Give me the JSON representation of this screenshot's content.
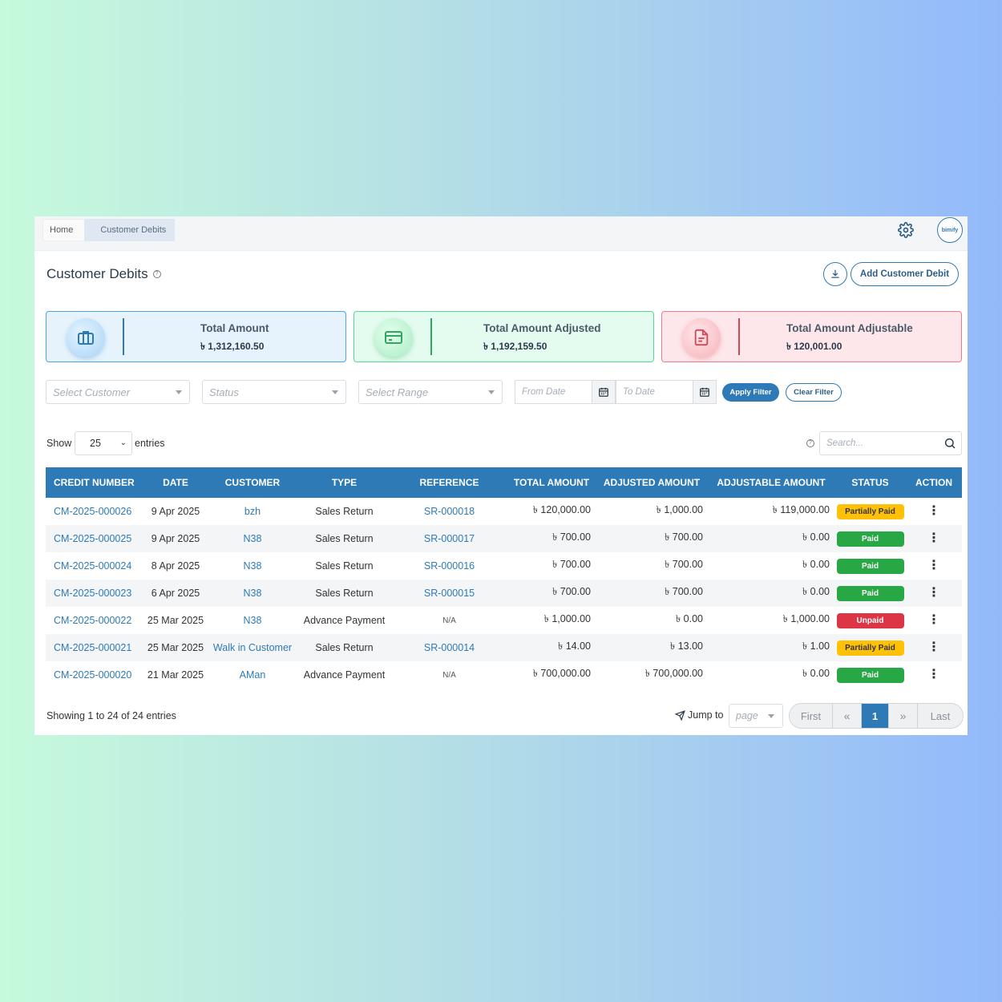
{
  "breadcrumb": {
    "home": "Home",
    "current": "Customer Debits"
  },
  "header": {
    "logo_text": "bimify"
  },
  "page": {
    "title": "Customer Debits",
    "add_button": "Add Customer Debit"
  },
  "cards": [
    {
      "title": "Total Amount",
      "amount": "৳ 1,312,160.50"
    },
    {
      "title": "Total Amount Adjusted",
      "amount": "৳ 1,192,159.50"
    },
    {
      "title": "Total Amount Adjustable",
      "amount": "৳ 120,001.00"
    }
  ],
  "filters": {
    "customer_placeholder": "Select Customer",
    "status_placeholder": "Status",
    "range_placeholder": "Select Range",
    "from_date_placeholder": "From Date",
    "to_date_placeholder": "To Date",
    "apply_label": "Apply Filter",
    "clear_label": "Clear Filter"
  },
  "entries": {
    "show_label": "Show",
    "value": "25",
    "suffix": "entries"
  },
  "search": {
    "placeholder": "Search..."
  },
  "table": {
    "columns": [
      "CREDIT NUMBER",
      "DATE",
      "CUSTOMER",
      "TYPE",
      "REFERENCE",
      "TOTAL AMOUNT",
      "ADJUSTED AMOUNT",
      "ADJUSTABLE AMOUNT",
      "STATUS",
      "ACTION"
    ],
    "rows": [
      {
        "credit": "CM-2025-000026",
        "date": "9 Apr 2025",
        "customer": "bzh",
        "type": "Sales Return",
        "reference": "SR-000018",
        "total": "৳ 120,000.00",
        "adjusted": "৳ 1,000.00",
        "adjustable": "৳ 119,000.00",
        "status": "Partially Paid",
        "status_kind": "partial"
      },
      {
        "credit": "CM-2025-000025",
        "date": "9 Apr 2025",
        "customer": "N38",
        "type": "Sales Return",
        "reference": "SR-000017",
        "total": "৳ 700.00",
        "adjusted": "৳ 700.00",
        "adjustable": "৳ 0.00",
        "status": "Paid",
        "status_kind": "paid"
      },
      {
        "credit": "CM-2025-000024",
        "date": "8 Apr 2025",
        "customer": "N38",
        "type": "Sales Return",
        "reference": "SR-000016",
        "total": "৳ 700.00",
        "adjusted": "৳ 700.00",
        "adjustable": "৳ 0.00",
        "status": "Paid",
        "status_kind": "paid"
      },
      {
        "credit": "CM-2025-000023",
        "date": "6 Apr 2025",
        "customer": "N38",
        "type": "Sales Return",
        "reference": "SR-000015",
        "total": "৳ 700.00",
        "adjusted": "৳ 700.00",
        "adjustable": "৳ 0.00",
        "status": "Paid",
        "status_kind": "paid"
      },
      {
        "credit": "CM-2025-000022",
        "date": "25 Mar 2025",
        "customer": "N38",
        "type": "Advance Payment",
        "reference": "N/A",
        "total": "৳ 1,000.00",
        "adjusted": "৳ 0.00",
        "adjustable": "৳ 1,000.00",
        "status": "Unpaid",
        "status_kind": "unpaid"
      },
      {
        "credit": "CM-2025-000021",
        "date": "25 Mar 2025",
        "customer": "Walk in Customer",
        "type": "Sales Return",
        "reference": "SR-000014",
        "total": "৳ 14.00",
        "adjusted": "৳ 13.00",
        "adjustable": "৳ 1.00",
        "status": "Partially Paid",
        "status_kind": "partial"
      },
      {
        "credit": "CM-2025-000020",
        "date": "21 Mar 2025",
        "customer": "AMan",
        "type": "Advance Payment",
        "reference": "N/A",
        "total": "৳ 700,000.00",
        "adjusted": "৳ 700,000.00",
        "adjustable": "৳ 0.00",
        "status": "Paid",
        "status_kind": "paid"
      }
    ]
  },
  "footer": {
    "showing": "Showing 1 to 24 of 24 entries",
    "jump_label": "Jump to",
    "page_placeholder": "page",
    "first": "First",
    "prev": "«",
    "current_page": "1",
    "next": "»",
    "last": "Last"
  }
}
